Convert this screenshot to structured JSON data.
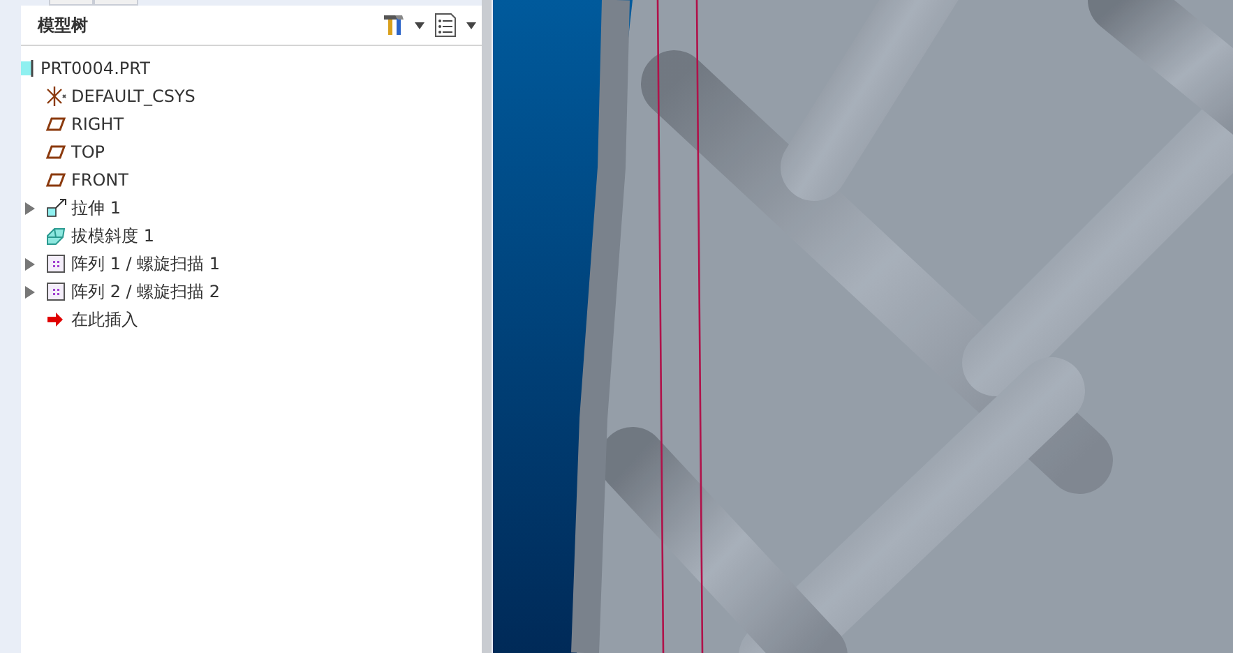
{
  "model_tree": {
    "title": "模型树",
    "root": {
      "label": "PRT0004.PRT",
      "kind": "part",
      "children": [
        {
          "label": "DEFAULT_CSYS",
          "kind": "csys",
          "expandable": false
        },
        {
          "label": "RIGHT",
          "kind": "plane",
          "expandable": false
        },
        {
          "label": "TOP",
          "kind": "plane",
          "expandable": false
        },
        {
          "label": "FRONT",
          "kind": "plane",
          "expandable": false
        },
        {
          "label": "拉伸 1",
          "kind": "extrude",
          "expandable": true
        },
        {
          "label": "拔模斜度 1",
          "kind": "draft",
          "expandable": false
        },
        {
          "label": "阵列 1 / 螺旋扫描 1",
          "kind": "pattern",
          "expandable": true
        },
        {
          "label": "阵列 2 / 螺旋扫描 2",
          "kind": "pattern",
          "expandable": true
        },
        {
          "label": "在此插入",
          "kind": "insert",
          "expandable": false
        }
      ]
    }
  }
}
